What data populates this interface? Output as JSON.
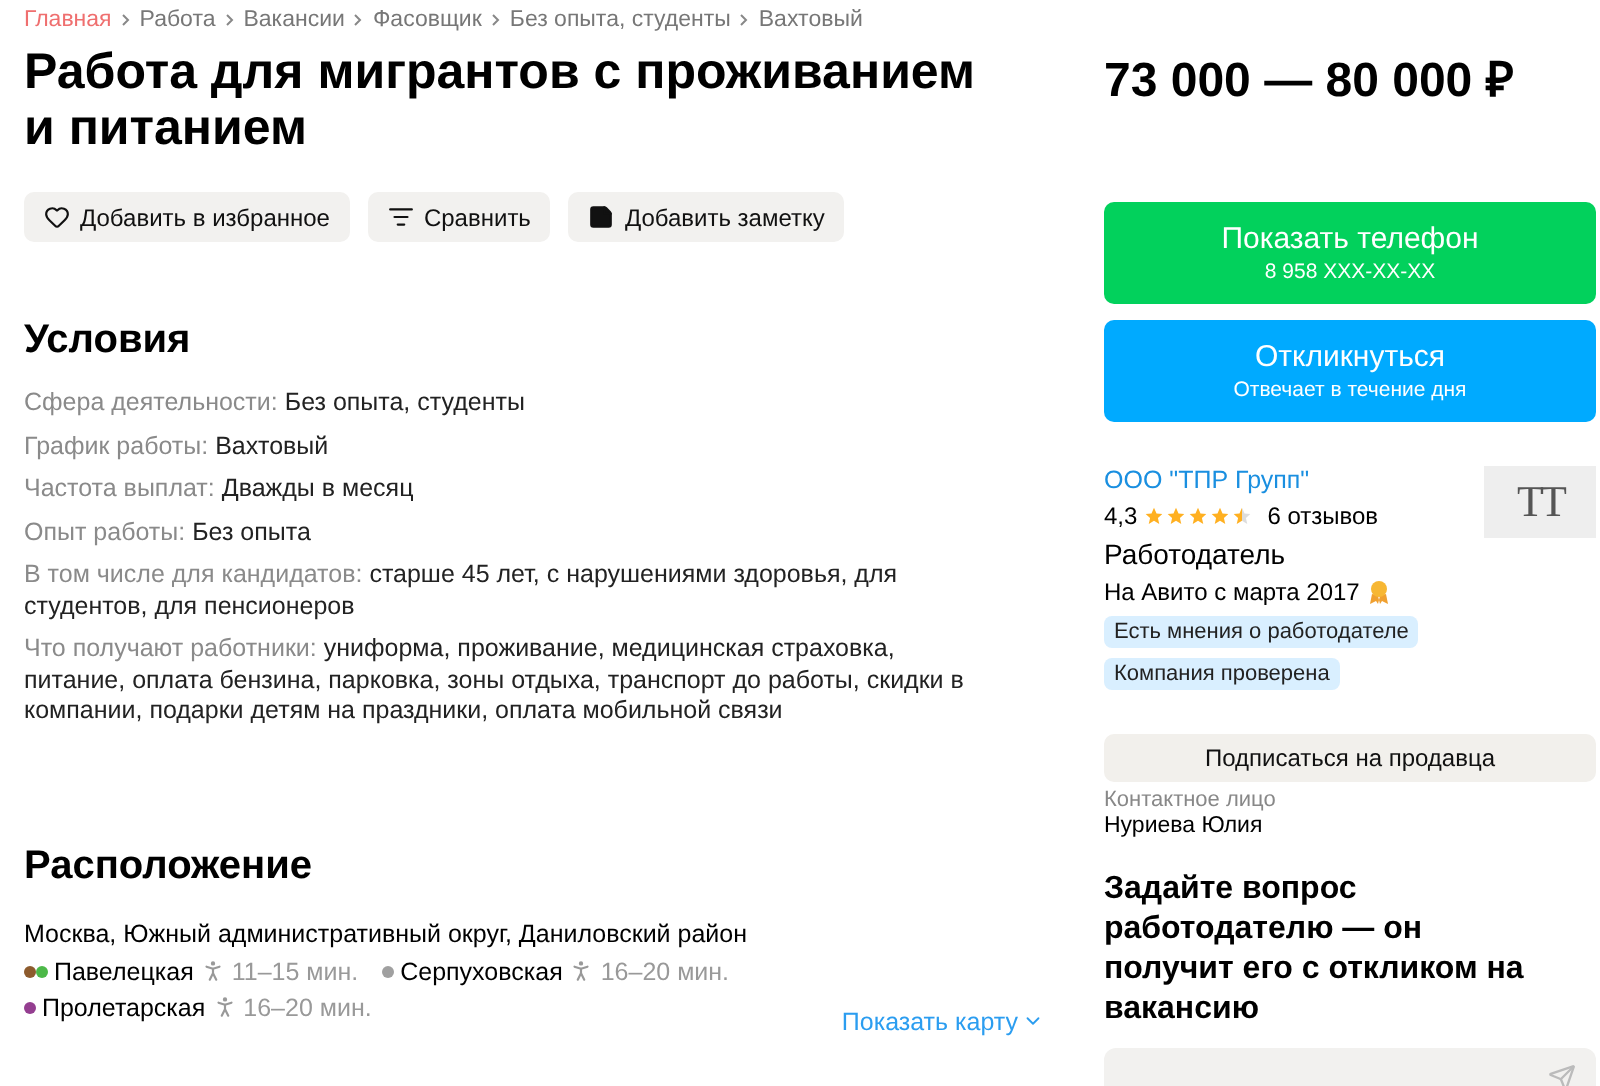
{
  "breadcrumbs": [
    {
      "label": "Главная",
      "kind": "home"
    },
    {
      "label": "Работа",
      "kind": "link"
    },
    {
      "label": "Вакансии",
      "kind": "link"
    },
    {
      "label": "Фасовщик",
      "kind": "link"
    },
    {
      "label": "Без опыта, студенты",
      "kind": "link"
    },
    {
      "label": "Вахтовый",
      "kind": "link"
    }
  ],
  "title": "Работа для мигрантов с проживанием и питанием",
  "actions": [
    {
      "label": "Добавить в избранное",
      "kind": "favorite"
    },
    {
      "label": "Сравнить",
      "kind": "compare"
    },
    {
      "label": "Добавить заметку",
      "kind": "note"
    }
  ],
  "conditions": {
    "heading": "Условия",
    "rows": [
      {
        "label": "Сфера деятельности:",
        "value": "Без опыта, студенты"
      },
      {
        "label": "График работы:",
        "value": "Вахтовый"
      },
      {
        "label": "Частота выплат:",
        "value": "Дважды в месяц"
      },
      {
        "label": "Опыт работы:",
        "value": "Без опыта"
      },
      {
        "label": "В том числе для кандидатов:",
        "value": "старше 45 лет, с нарушениями здоровья, для студентов, для пенсионеров"
      },
      {
        "label": "Что получают работники:",
        "value": "униформа, проживание, медицинская страховка, питание, оплата бензина, парковка, зоны отдыха, транспорт до работы, скидки в компании, подарки детям на праздники, оплата мобильной связи"
      }
    ]
  },
  "location": {
    "heading": "Расположение",
    "address": "Москва, Южный административный округ, Даниловский район",
    "stations": [
      {
        "name": "Павелецкая",
        "walk": "11–15 мин.",
        "lines": [
          {
            "color": "#8d5b2d"
          },
          {
            "color": "#4cb848"
          }
        ]
      },
      {
        "name": "Серпуховская",
        "walk": "16–20 мин.",
        "lines": [
          {
            "color": "#a0a0a0"
          }
        ]
      },
      {
        "name": "Пролетарская",
        "walk": "16–20 мин.",
        "lines": [
          {
            "color": "#943e90"
          }
        ]
      }
    ],
    "map_link": "Показать карту"
  },
  "price": "73 000 — 80 000 ₽",
  "phone_button": {
    "label": "Показать телефон",
    "sub": "8 958 XXX-XX-XX"
  },
  "respond_button": {
    "label": "Откликнуться",
    "sub": "Отвечает в течение дня"
  },
  "employer": {
    "name": "ООО \"ТПР Групп\"",
    "rating": "4,3",
    "stars": 4.5,
    "reviews": "6 отзывов",
    "type": "Работодатель",
    "since": "На Авито с марта 2017",
    "logo_text": "TT",
    "badges": [
      "Есть мнения о работодателе",
      "Компания проверена"
    ]
  },
  "subscribe_button": "Подписаться на продавца",
  "contact": {
    "label": "Контактное лицо",
    "name": "Нуриева Юлия"
  },
  "question": {
    "heading": "Задайте вопрос работодателю — он получит его с откликом на вакансию"
  }
}
